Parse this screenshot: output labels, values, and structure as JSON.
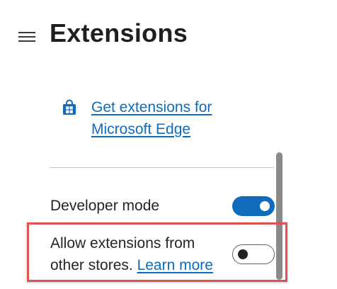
{
  "header": {
    "title": "Extensions",
    "menu_icon": "hamburger-menu-icon"
  },
  "store": {
    "icon": "store-bag-icon",
    "link_text": "Get extensions for Microsoft Edge"
  },
  "settings": {
    "developer_mode": {
      "label": "Developer mode",
      "enabled": true
    },
    "allow_other_stores": {
      "label": "Allow extensions from other stores.",
      "link_text": "Learn more",
      "enabled": false
    }
  },
  "colors": {
    "accent": "#0f6cbd",
    "highlight": "#e05252",
    "text": "#242424"
  }
}
